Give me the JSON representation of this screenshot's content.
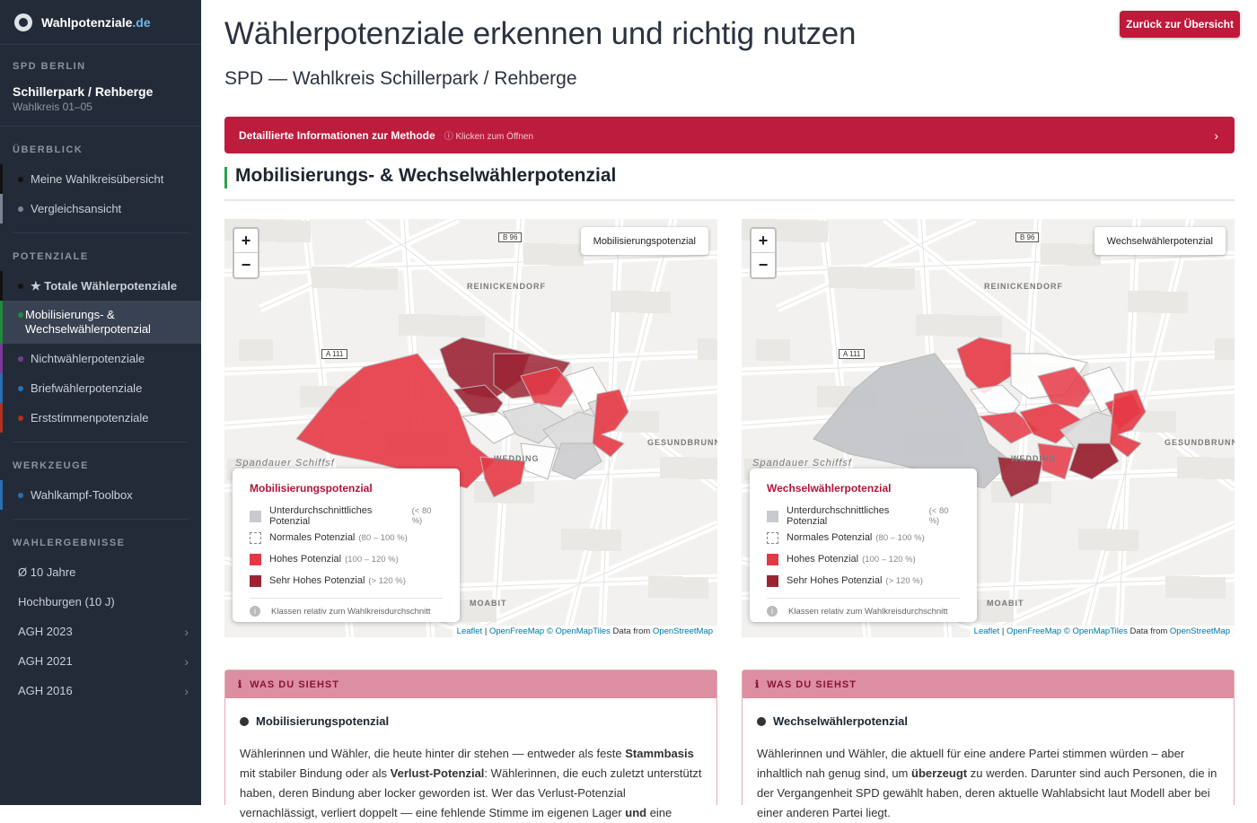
{
  "brand": {
    "name": "Wahlpotenziale",
    "tld": ".de"
  },
  "sidebar": {
    "party": "SPD BERLIN",
    "area": "Schillerpark / Rehberge",
    "district": "Wahlkreis 01–05",
    "sections": [
      {
        "title": "ÜBERBLICK",
        "items": [
          {
            "label": "Meine Wahlkreisübersicht",
            "color": "#111111"
          },
          {
            "label": "Vergleichsansicht",
            "color": "#7a8594"
          }
        ]
      },
      {
        "title": "POTENZIALE",
        "items": [
          {
            "label": "★ Totale Wählerpotenziale",
            "color": "#111111"
          },
          {
            "label": "Mobilisierungs- & Wechselwählerpotenzial",
            "color": "#1f8a3a"
          },
          {
            "label": "Nichtwählerpotenziale",
            "color": "#7b3a9a"
          },
          {
            "label": "Briefwählerpotenziale",
            "color": "#2a6fb0"
          },
          {
            "label": "Erststimmenpotenziale",
            "color": "#b1301f"
          }
        ]
      },
      {
        "title": "WERKZEUGE",
        "items": [
          {
            "label": "Wahlkampf-Toolbox",
            "color": "#2a6fb0"
          }
        ]
      },
      {
        "title": "WAHLERGEBNISSE",
        "items": [
          {
            "label": "Ø 10 Jahre"
          },
          {
            "label": "Hochburgen (10 J)"
          },
          {
            "label": "AGH 2023"
          },
          {
            "label": "AGH 2021"
          },
          {
            "label": "AGH 2016"
          }
        ]
      }
    ]
  },
  "header": {
    "title": "Wählerpotenziale erkennen und richtig nutzen",
    "subtitle": "SPD — Wahlkreis Schillerpark / Rehberge",
    "back": "Zurück zur Übersicht"
  },
  "method": {
    "title": "Detaillierte Informationen zur Methode",
    "hint": "ⓘ Klicken zum Öffnen",
    "chevron": "›"
  },
  "section_title": "Mobilisierungs- & Wechselwählerpotenzial",
  "map_common": {
    "zoom_in": "+",
    "zoom_out": "−",
    "labels": {
      "reinickendorf": "REINICKENDORF",
      "wedding": "WEDDING",
      "gesundbrunnen": "GESUNDBRUNNEN",
      "moabit": "MOABIT",
      "spandauer": "Spandauer Schiffsf",
      "b96": "B 96",
      "a111": "A 111"
    },
    "legend_rows": [
      {
        "label": "Unterdurchschnittliches Potenzial",
        "range": "(< 80 %)",
        "color": "#c8cacd"
      },
      {
        "label": "Normales Potenzial",
        "range": "(80 – 100 %)",
        "color": "#ffffff"
      },
      {
        "label": "Hohes Potenzial",
        "range": "(100 – 120 %)",
        "color": "#e53845"
      },
      {
        "label": "Sehr Hohes Potenzial",
        "range": "(> 120 %)",
        "color": "#9b2434"
      }
    ],
    "legend_note": "Klassen relativ zum Wahlkreisdurchschnitt",
    "attribution": {
      "leaflet": "Leaflet",
      "sep": " | ",
      "ofm": "OpenFreeMap",
      "copy": " © ",
      "omt": "OpenMapTiles",
      "data": " Data from ",
      "osm": "OpenStreetMap"
    }
  },
  "maps": [
    {
      "badge": "Mobilisierungspotenzial",
      "legend_title": "Mobilisierungspotenzial"
    },
    {
      "badge": "Wechselwählerpotenzial",
      "legend_title": "Wechselwählerpotenzial"
    }
  ],
  "info": [
    {
      "tag": "WAS DU SIEHST",
      "icon": "ℹ",
      "heading": "Mobilisierungspotenzial",
      "t1": "Wählerinnen und Wähler, die heute hinter dir stehen — entweder als feste ",
      "b1": "Stammbasis",
      "t2": " mit stabiler Bindung oder als ",
      "b2": "Verlust-Potenzial",
      "t3": ": Wählerinnen, die euch zuletzt unterstützt haben, deren Bindung aber locker geworden ist. Wer das Verlust-Potenzial vernachlässigt, verliert doppelt — eine fehlende Stimme im eigenen Lager ",
      "b3": "und",
      "t4": " eine"
    },
    {
      "tag": "WAS DU SIEHST",
      "icon": "ℹ",
      "heading": "Wechselwählerpotenzial",
      "t1": "Wählerinnen und Wähler, die aktuell für eine andere Partei stimmen würden – aber inhaltlich nah genug sind, um ",
      "b1": "überzeugt",
      "t2": " zu werden. Darunter sind auch Personen, die in der Vergangenheit SPD gewählt haben, deren aktuelle Wahlabsicht laut Modell aber bei einer anderen Partei liegt.",
      "b2": "",
      "t3": "",
      "b3": "",
      "t4": ""
    }
  ]
}
